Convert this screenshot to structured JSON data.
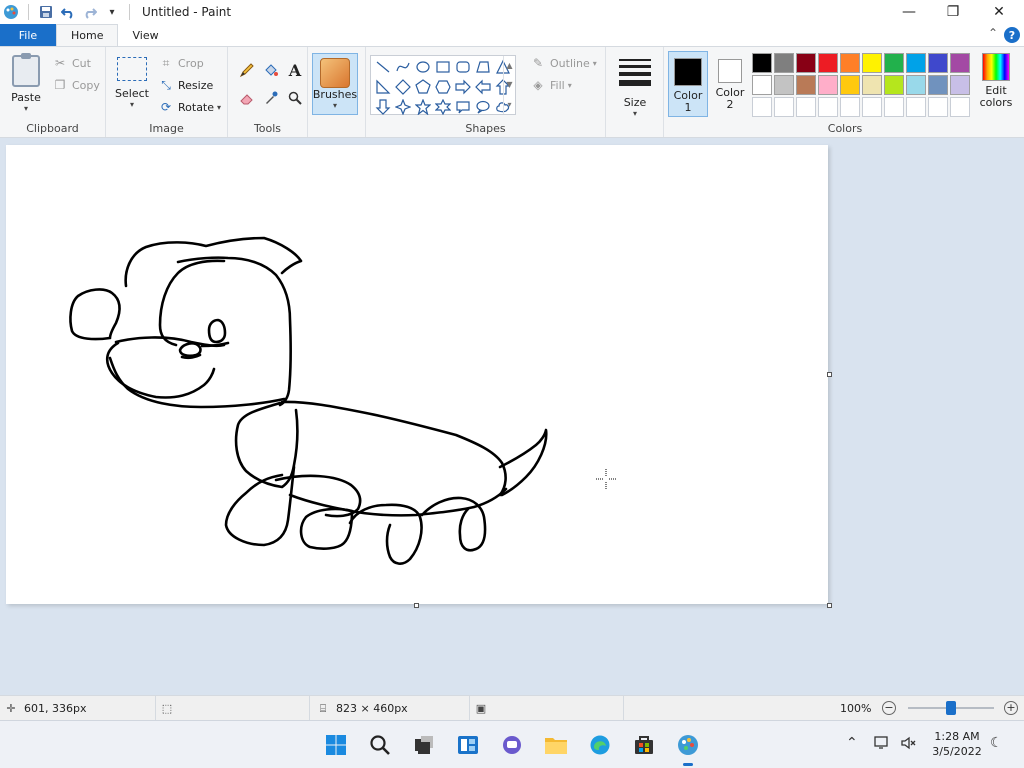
{
  "window": {
    "title": "Untitled - Paint",
    "minimize_glyph": "—",
    "maximize_glyph": "❐",
    "close_glyph": "✕"
  },
  "tabs": [
    {
      "label": "File"
    },
    {
      "label": "Home"
    },
    {
      "label": "View"
    }
  ],
  "help_glyph": "?",
  "clipboard": {
    "group_label": "Clipboard",
    "paste_label": "Paste",
    "cut_label": "Cut",
    "copy_label": "Copy"
  },
  "image": {
    "group_label": "Image",
    "select_label": "Select",
    "crop_label": "Crop",
    "resize_label": "Resize",
    "rotate_label": "Rotate"
  },
  "tools": {
    "group_label": "Tools",
    "text_glyph": "A"
  },
  "brushes": {
    "label": "Brushes"
  },
  "shapes": {
    "group_label": "Shapes",
    "outline_label": "Outline",
    "fill_label": "Fill"
  },
  "size": {
    "label": "Size"
  },
  "colors": {
    "group_label": "Colors",
    "color1_label_line1": "Color",
    "color1_label_line2": "1",
    "color2_label_line1": "Color",
    "color2_label_line2": "2",
    "color1": "#000000",
    "color2": "#ffffff",
    "edit_label_line1": "Edit",
    "edit_label_line2": "colors",
    "palette_row1": [
      "#000000",
      "#7f7f7f",
      "#880015",
      "#ed1c24",
      "#ff7f27",
      "#fff200",
      "#22b14c",
      "#00a2e8",
      "#3f48cc",
      "#a349a4"
    ],
    "palette_row2": [
      "#ffffff",
      "#c3c3c3",
      "#b97a57",
      "#ffaec9",
      "#ffc90e",
      "#efe4b0",
      "#b5e61d",
      "#99d9ea",
      "#7092be",
      "#c8bfe7"
    ],
    "palette_row3": [
      "#ffffff",
      "#ffffff",
      "#ffffff",
      "#ffffff",
      "#ffffff",
      "#ffffff",
      "#ffffff",
      "#ffffff",
      "#ffffff",
      "#ffffff"
    ]
  },
  "status": {
    "cursor_position": "601, 336px",
    "canvas_size": "823 × 460px",
    "zoom": "100%",
    "zoom_fraction": 0.5
  },
  "taskbar": {
    "time": "1:28 AM",
    "date": "3/5/2022"
  }
}
